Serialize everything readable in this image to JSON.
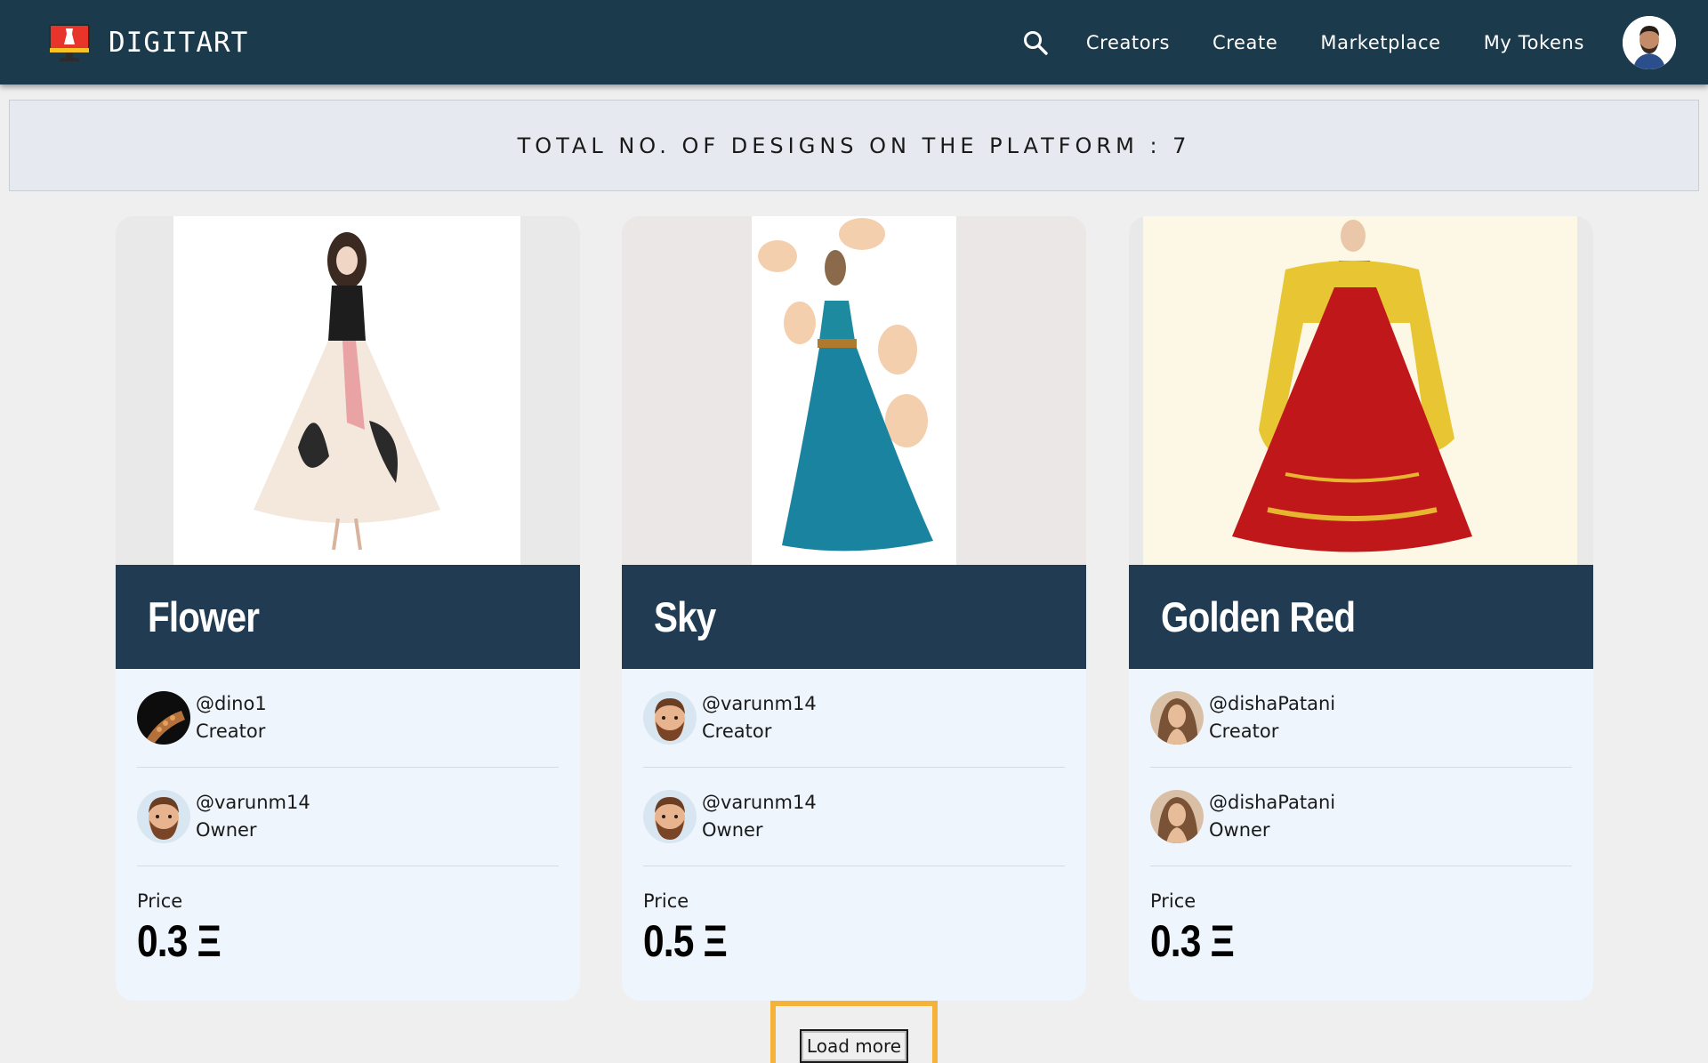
{
  "nav": {
    "brand": "DIGITART",
    "links": [
      "Creators",
      "Create",
      "Marketplace",
      "My Tokens"
    ]
  },
  "banner": {
    "text": "TOTAL NO. OF DESIGNS ON THE PLATFORM : 7"
  },
  "cards": [
    {
      "title": "Flower",
      "creator_handle": "@dino1",
      "creator_role": "Creator",
      "owner_handle": "@varunm14",
      "owner_role": "Owner",
      "price_label": "Price",
      "price": "0.3 Ξ"
    },
    {
      "title": "Sky",
      "creator_handle": "@varunm14",
      "creator_role": "Creator",
      "owner_handle": "@varunm14",
      "owner_role": "Owner",
      "price_label": "Price",
      "price": "0.5 Ξ"
    },
    {
      "title": "Golden Red",
      "creator_handle": "@dishaPatani",
      "creator_role": "Creator",
      "owner_handle": "@dishaPatani",
      "owner_role": "Owner",
      "price_label": "Price",
      "price": "0.3 Ξ"
    }
  ],
  "load_more": "Load more",
  "colors": {
    "navbar": "#1b3a4b",
    "card_title_bar": "#213c52",
    "card_body": "#eef5fc",
    "highlight": "#f4b338"
  },
  "icons": {
    "search": "search-icon",
    "logo": "monitor-dress-logo-icon"
  }
}
